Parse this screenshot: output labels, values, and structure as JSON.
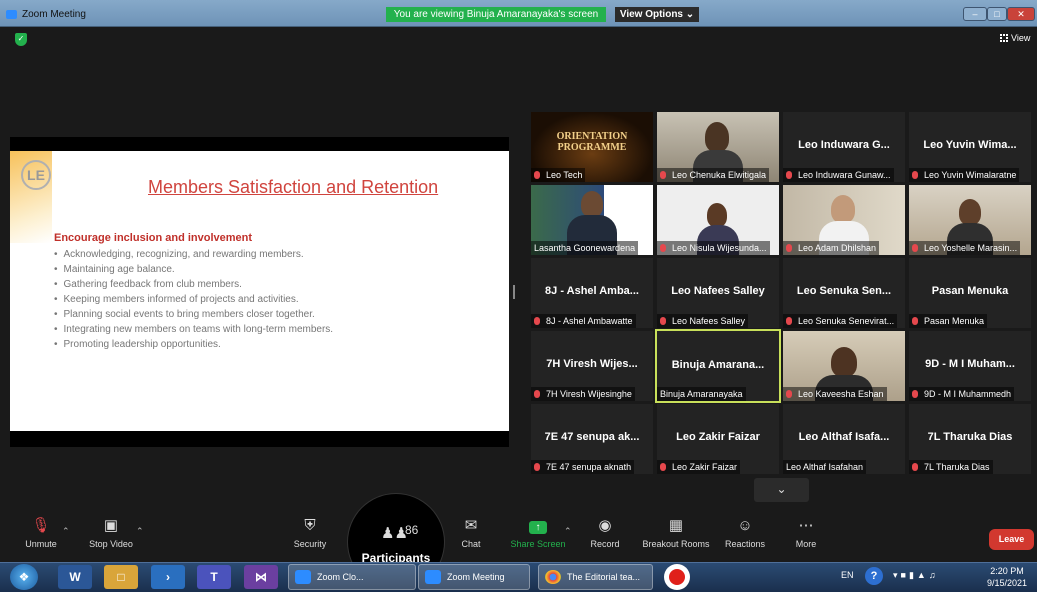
{
  "window": {
    "title": "Zoom Meeting",
    "share_banner": "You are viewing Binuja Amaranayaka's screen",
    "view_options": "View Options ⌄",
    "view_button": "View"
  },
  "slide": {
    "logo": "LE",
    "title": "Members Satisfaction and Retention",
    "subtitle": "Encourage inclusion and involvement",
    "bullets": [
      "Acknowledging, recognizing, and rewarding members.",
      "Maintaining age balance.",
      "Gathering feedback from club members.",
      "Keeping members informed of projects and activities.",
      "Planning social events to bring members closer together.",
      "Integrating new members on teams with long-term members.",
      "Promoting leadership opportunities."
    ]
  },
  "orientation": {
    "line1": "ORIENTATION",
    "line2": "PROGRAMME"
  },
  "tiles": [
    {
      "label": "Leo Tech",
      "muted": true,
      "big": ""
    },
    {
      "label": "Leo Chenuka Elwitigala",
      "muted": true,
      "big": ""
    },
    {
      "label": "Leo Induwara Gunaw...",
      "muted": true,
      "big": "Leo Induwara G..."
    },
    {
      "label": "Leo Yuvin Wimalaratne",
      "muted": true,
      "big": "Leo Yuvin Wima..."
    },
    {
      "label": "Lasantha Goonewardena",
      "muted": false,
      "big": ""
    },
    {
      "label": "Leo Nisula Wijesunda...",
      "muted": true,
      "big": ""
    },
    {
      "label": "Leo Adam Dhilshan",
      "muted": true,
      "big": ""
    },
    {
      "label": "Leo Yoshelle Marasin...",
      "muted": true,
      "big": ""
    },
    {
      "label": "8J - Ashel Ambawatte",
      "muted": true,
      "big": "8J - Ashel Amba..."
    },
    {
      "label": "Leo Nafees Salley",
      "muted": true,
      "big": "Leo Nafees Salley"
    },
    {
      "label": "Leo Senuka Senevirat...",
      "muted": true,
      "big": "Leo Senuka Sen..."
    },
    {
      "label": "Pasan Menuka",
      "muted": true,
      "big": "Pasan Menuka"
    },
    {
      "label": "7H  Viresh Wijesinghe",
      "muted": true,
      "big": "7H  Viresh Wijes..."
    },
    {
      "label": "Binuja Amaranayaka",
      "muted": false,
      "big": "Binuja Amarana..."
    },
    {
      "label": "Leo Kaveesha Eshan",
      "muted": true,
      "big": ""
    },
    {
      "label": "9D - M I Muhammedh",
      "muted": true,
      "big": "9D - M I Muham..."
    },
    {
      "label": "7E 47 senupa aknath",
      "muted": true,
      "big": "7E 47 senupa ak..."
    },
    {
      "label": "Leo Zakir Faizar",
      "muted": true,
      "big": "Leo Zakir Faizar"
    },
    {
      "label": "Leo Althaf Isafahan",
      "muted": false,
      "big": "Leo Althaf Isafa..."
    },
    {
      "label": "7L Tharuka Dias",
      "muted": true,
      "big": "7L Tharuka Dias"
    }
  ],
  "toolbar": {
    "unmute": "Unmute",
    "stop_video": "Stop Video",
    "security": "Security",
    "participants_count": "86",
    "participants": "Participants",
    "chat": "Chat",
    "share_screen": "Share Screen",
    "record": "Record",
    "breakout_rooms": "Breakout Rooms",
    "reactions": "Reactions",
    "more": "More",
    "leave": "Leave"
  },
  "taskbar": {
    "zoom_cloud": "Zoom Clo...",
    "zoom_meeting": "Zoom Meeting",
    "chrome_tab": "The Editorial tea...",
    "lang": "EN",
    "time": "2:20 PM",
    "date": "9/15/2021"
  },
  "colors": {
    "accent_green": "#23b14d",
    "leave_red": "#d2382f",
    "slide_title_red": "#d0443e",
    "active_speaker": "#c8e05a"
  }
}
